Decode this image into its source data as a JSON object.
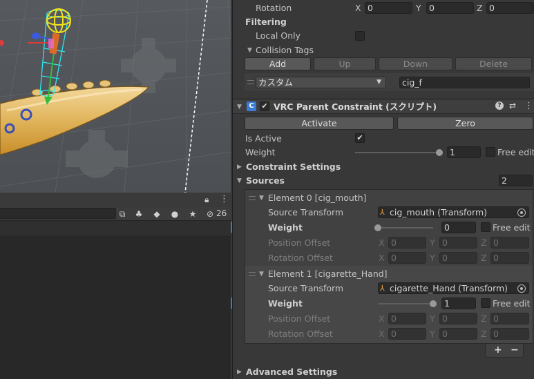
{
  "scene": {
    "label": "scene-view"
  },
  "lower_panel": {
    "icons": [
      "lock-icon",
      "more-icon",
      "search-field-icon",
      "filter-icon",
      "tag-icon",
      "warning-icon",
      "star-icon",
      "hidden-eye-icon"
    ],
    "hidden_count": "26"
  },
  "collision": {
    "rotation_label": "Rotation",
    "rotation": {
      "x_label": "X",
      "x": "0",
      "y_label": "Y",
      "y": "0",
      "z_label": "Z",
      "z": "0"
    },
    "filtering_label": "Filtering",
    "local_only_label": "Local Only",
    "local_only": false,
    "collision_tags_label": "Collision Tags",
    "buttons": {
      "add": "Add",
      "up": "Up",
      "down": "Down",
      "delete": "Delete"
    },
    "tag_dropdown": "カスタム",
    "tag_value": "cig_f"
  },
  "component": {
    "title": "VRC Parent Constraint (スクリプト)",
    "enabled": true,
    "activate_label": "Activate",
    "zero_label": "Zero",
    "is_active_label": "Is Active",
    "is_active": true,
    "weight_label": "Weight",
    "weight_value": "1",
    "weight_fraction": 1.0,
    "free_edit_label": "Free edit",
    "constraint_settings_label": "Constraint Settings",
    "sources_label": "Sources",
    "sources_count": "2",
    "elements": [
      {
        "header": "Element 0 [cig_mouth]",
        "source_transform_label": "Source Transform",
        "source_transform": "cig_mouth (Transform)",
        "weight_label": "Weight",
        "weight_value": "0",
        "weight_fraction": 0.0,
        "free_edit_label": "Free edit",
        "position_offset_label": "Position Offset",
        "position_offset": {
          "x_label": "X",
          "x": "0",
          "y_label": "Y",
          "y": "0",
          "z_label": "Z",
          "z": "0"
        },
        "rotation_offset_label": "Rotation Offset",
        "rotation_offset": {
          "x_label": "X",
          "x": "0",
          "y_label": "Y",
          "y": "0",
          "z_label": "Z",
          "z": "0"
        }
      },
      {
        "header": "Element 1 [cigarette_Hand]",
        "source_transform_label": "Source Transform",
        "source_transform": "cigarette_Hand (Transform)",
        "weight_label": "Weight",
        "weight_value": "1",
        "weight_fraction": 1.0,
        "free_edit_label": "Free edit",
        "position_offset_label": "Position Offset",
        "position_offset": {
          "x_label": "X",
          "x": "0",
          "y_label": "Y",
          "y": "0",
          "z_label": "Z",
          "z": "0"
        },
        "rotation_offset_label": "Rotation Offset",
        "rotation_offset": {
          "x_label": "X",
          "x": "0",
          "y_label": "Y",
          "y": "0",
          "z_label": "Z",
          "z": "0"
        }
      }
    ],
    "add_label": "+",
    "remove_label": "−",
    "advanced_settings_label": "Advanced Settings"
  },
  "colors": {
    "accent": "#2d7ee0",
    "gizmo_yellow": "#f2e21a",
    "gizmo_cyan": "#30e6f0",
    "panel": "#383838"
  }
}
